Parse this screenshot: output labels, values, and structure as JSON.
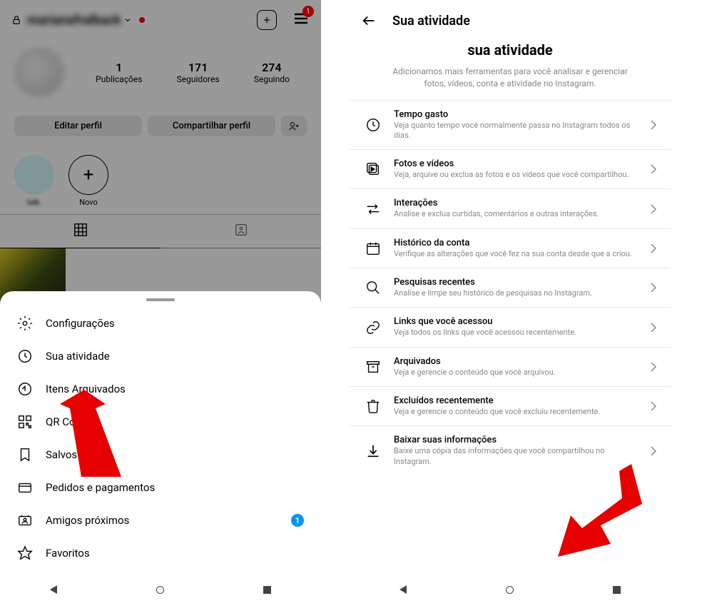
{
  "left": {
    "username": "marianafralback",
    "menu_badge": "1",
    "stats": [
      {
        "num": "1",
        "label": "Publicações"
      },
      {
        "num": "171",
        "label": "Seguidores"
      },
      {
        "num": "274",
        "label": "Seguindo"
      }
    ],
    "edit_btn": "Editar perfil",
    "share_btn": "Compartilhar perfil",
    "story_blur": "talk.",
    "story_new": "Novo",
    "sheet_items": [
      {
        "icon": "gear",
        "label": "Configurações"
      },
      {
        "icon": "clock",
        "label": "Sua atividade"
      },
      {
        "icon": "archive",
        "label": "Itens Arquivados"
      },
      {
        "icon": "qr",
        "label": "QR Code"
      },
      {
        "icon": "bookmark",
        "label": "Salvos"
      },
      {
        "icon": "card",
        "label": "Pedidos e pagamentos"
      },
      {
        "icon": "people",
        "label": "Amigos próximos",
        "badge": "1"
      },
      {
        "icon": "star",
        "label": "Favoritos"
      }
    ]
  },
  "right": {
    "header_title": "Sua atividade",
    "subtitle": "sua atividade",
    "description": "Adicionamos mais ferramentas para você analisar e gerenciar fotos, vídeos, conta e atividade no Instagram.",
    "items": [
      {
        "icon": "clock",
        "title": "Tempo gasto",
        "sub": "Veja quanto tempo você normalmente passa no Instagram todos os dias."
      },
      {
        "icon": "photos",
        "title": "Fotos e vídeos",
        "sub": "Veja, arquive ou exclua as fotos e os vídeos que você compartilhou."
      },
      {
        "icon": "arrows",
        "title": "Interações",
        "sub": "Analise e exclua curtidas, comentários e outras interações."
      },
      {
        "icon": "calendar",
        "title": "Histórico da conta",
        "sub": "Verifique as alterações que você fez na sua conta desde que a criou."
      },
      {
        "icon": "search",
        "title": "Pesquisas recentes",
        "sub": "Analise e limpe seu histórico de pesquisas no Instagram."
      },
      {
        "icon": "link",
        "title": "Links que você acessou",
        "sub": "Veja todos os links que você acessou recentemente."
      },
      {
        "icon": "archive",
        "title": "Arquivados",
        "sub": "Veja e gerencie o conteúdo que você arquivou."
      },
      {
        "icon": "trash",
        "title": "Excluídos recentemente",
        "sub": "Veja e gerencie o conteúdo que você excluiu recentemente."
      },
      {
        "icon": "download",
        "title": "Baixar suas informações",
        "sub": "Baixe uma cópia das informações que você compartilhou no Instagram."
      }
    ]
  }
}
